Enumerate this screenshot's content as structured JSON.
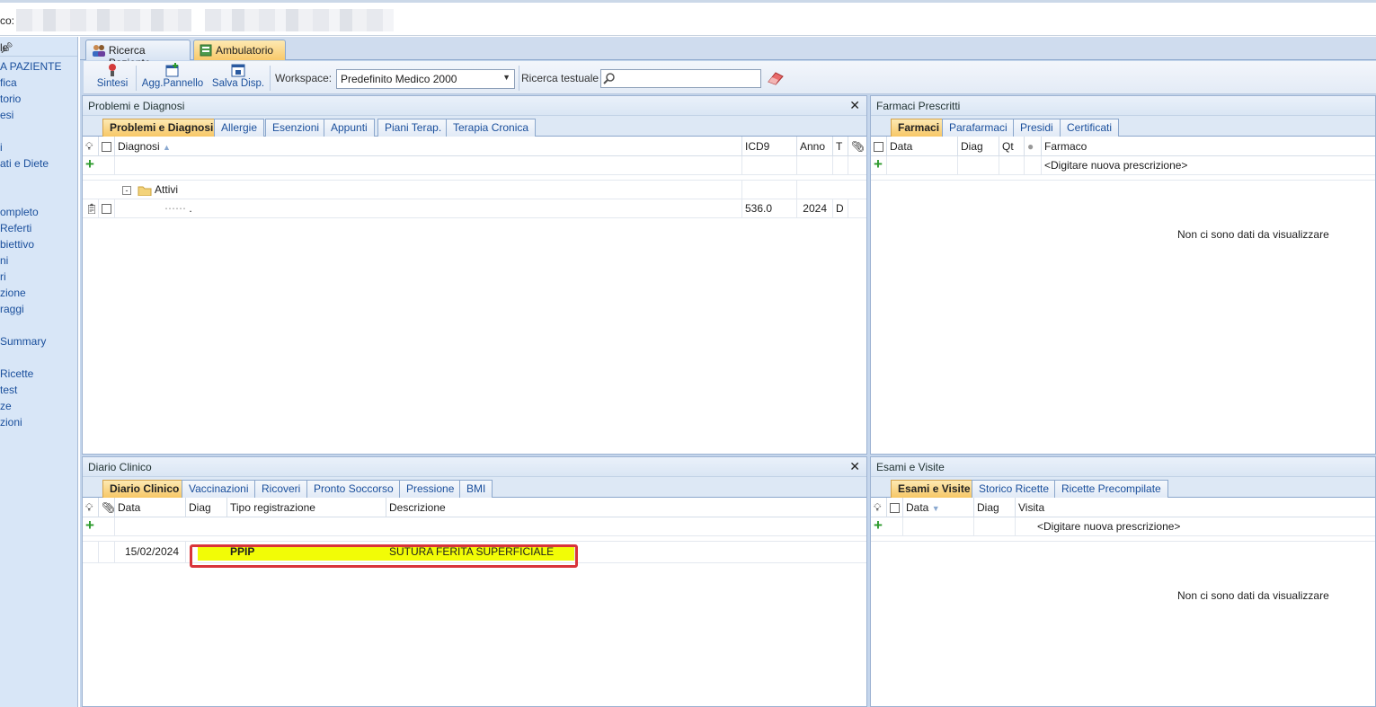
{
  "top": {
    "label": "co:"
  },
  "sidebar": {
    "header": "le",
    "items": [
      "A PAZIENTE",
      "fica",
      "torio",
      "esi",
      "",
      "i",
      "ati e Diete",
      "",
      "",
      "ompleto",
      "Referti",
      "biettivo",
      "ni",
      "ri",
      "zione",
      "raggi",
      "",
      "Summary",
      "",
      "Ricette",
      "test",
      "ze",
      "zioni"
    ]
  },
  "tabs": [
    {
      "label": "Ricerca Paziente",
      "active": false
    },
    {
      "label": "Ambulatorio",
      "active": true
    }
  ],
  "toolbar": {
    "sintesi": "Sintesi",
    "agg_pannello": "Agg.Pannello",
    "salva_disp": "Salva Disp.",
    "workspace_label": "Workspace:",
    "workspace_value": "Predefinito Medico 2000",
    "search_label": "Ricerca testuale"
  },
  "problemi": {
    "title": "Problemi e Diagnosi",
    "tabs": [
      "Problemi e Diagnosi",
      "Allergie",
      "Esenzioni",
      "Appunti",
      "Piani Terap.",
      "Terapia Cronica"
    ],
    "cols": {
      "diagnosi": "Diagnosi",
      "icd9": "ICD9",
      "anno": "Anno",
      "t": "T"
    },
    "group": "Attivi",
    "row": {
      "diag": ".",
      "icd9": "536.0",
      "anno": "2024",
      "t": "D"
    }
  },
  "farmaci": {
    "title": "Farmaci Prescritti",
    "tabs": [
      "Farmaci",
      "Parafarmaci",
      "Presidi",
      "Certificati"
    ],
    "cols": {
      "data": "Data",
      "diag": "Diag",
      "qt": "Qt",
      "farmaco": "Farmaco"
    },
    "new_row": "<Digitare nuova prescrizione>",
    "empty": "Non ci sono dati da visualizzare"
  },
  "diario": {
    "title": "Diario Clinico",
    "tabs": [
      "Diario Clinico",
      "Vaccinazioni",
      "Ricoveri",
      "Pronto Soccorso",
      "Pressione",
      "BMI"
    ],
    "cols": {
      "data": "Data",
      "diag": "Diag",
      "tipo": "Tipo registrazione",
      "descrizione": "Descrizione"
    },
    "row": {
      "data": "15/02/2024",
      "tipo": "PPIP",
      "descrizione": "SUTURA FERITA SUPERFICIALE"
    },
    "highlight": "#f2fc06"
  },
  "esami": {
    "title": "Esami e Visite",
    "tabs": [
      "Esami e Visite",
      "Storico Ricette",
      "Ricette Precompilate"
    ],
    "cols": {
      "data": "Data",
      "diag": "Diag",
      "visita": "Visita"
    },
    "new_row": "<Digitare nuova prescrizione>",
    "empty": "Non ci sono dati da visualizzare"
  }
}
